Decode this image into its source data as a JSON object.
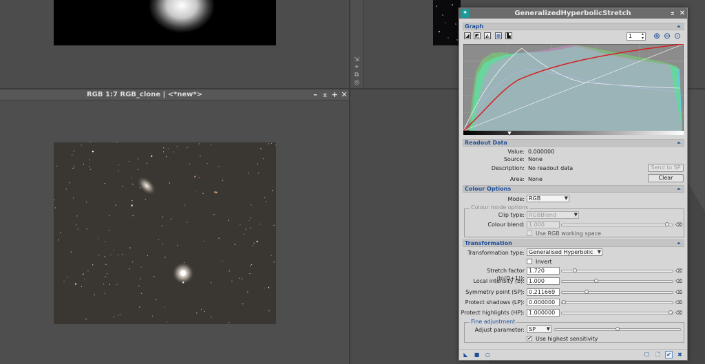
{
  "workspace": {
    "clone_window": {
      "title": "RGB 1:7 RGB_clone | <*new*>",
      "buttons": {
        "minimize": "–",
        "shade": "⌅",
        "maximize": "+",
        "close": "✕"
      }
    }
  },
  "dialog": {
    "title": "GeneralizedHyperbolicStretch",
    "title_buttons": {
      "shade": "⌅",
      "close": "✕"
    },
    "graph": {
      "section": "Graph",
      "zoom_value": "1",
      "zoom_in_icon": "⊕",
      "zoom_out_icon": "⊖",
      "zoom_reset_icon": "⊙"
    },
    "readout": {
      "section": "Readout Data",
      "value_label": "Value:",
      "value": "0.000000",
      "source_label": "Source:",
      "source": "None",
      "description_label": "Description:",
      "description": "No readout data",
      "area_label": "Area:",
      "area": "None",
      "send_button": "Send to SP",
      "clear_button": "Clear"
    },
    "colour": {
      "section": "Colour Options",
      "mode_label": "Mode:",
      "mode": "RGB",
      "group_title": "Colour mode options",
      "clip_type_label": "Clip type:",
      "clip_type": "RGBBlend",
      "blend_label": "Colour blend:",
      "blend": "1.000",
      "blend_fraction": 0.97,
      "working_space_label": "Use RGB working space"
    },
    "transformation": {
      "section": "Transformation",
      "type_label": "Transformation type:",
      "type": "Generalised Hyperbolic",
      "invert_label": "Invert",
      "params": [
        {
          "label": "Stretch factor (ln(D+1)):",
          "value": "1.720",
          "fraction": 0.1
        },
        {
          "label": "Local intensity (b):",
          "value": "1.000",
          "fraction": 0.3
        },
        {
          "label": "Symmetry point (SP):",
          "value": "0.211669",
          "fraction": 0.21
        },
        {
          "label": "Protect shadows (LP):",
          "value": "0.000000",
          "fraction": 0.0
        },
        {
          "label": "Protect highlights (HP):",
          "value": "1.000000",
          "fraction": 1.0
        }
      ]
    },
    "fine": {
      "group_title": "Fine adjustment",
      "adjust_label": "Adjust parameter:",
      "adjust_value": "SP",
      "adjust_fraction": 0.5,
      "sensitivity_label": "Use highest sensitivity",
      "sensitivity_checked": "✔"
    },
    "bottom": {
      "new_instance": "◣",
      "global": "■",
      "real_time": "○",
      "preview": "☐",
      "track": "🗋",
      "apply": "✔",
      "reset": "✖"
    }
  },
  "colors": {
    "accent": "#1f4f9a",
    "dialog_bg": "#d6d6d6",
    "title_bar": "#6b6b6b",
    "curve": "#d42020"
  }
}
